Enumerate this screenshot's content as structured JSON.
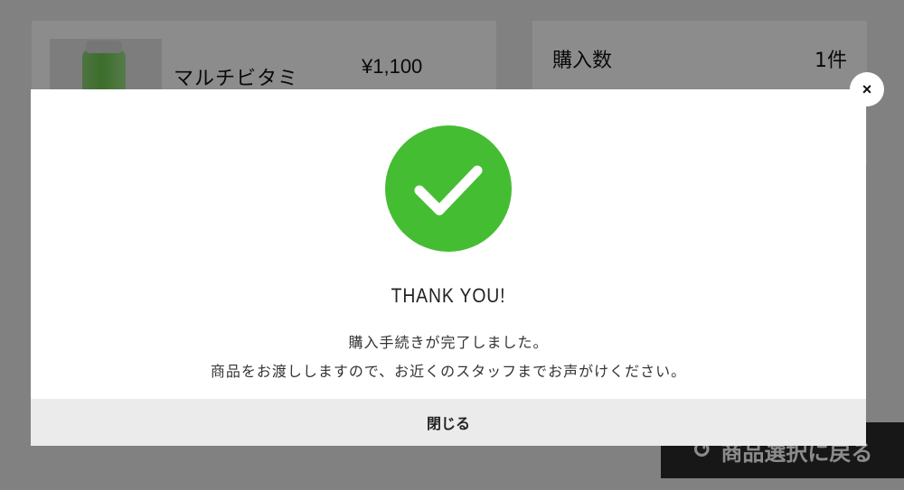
{
  "background": {
    "product": {
      "name": "マルチビタミ",
      "price": "¥1,100"
    },
    "summary": {
      "quantity_label": "購入数",
      "quantity_value": "1件"
    },
    "back_button": {
      "icon": "return-arrow-icon",
      "label": "商品選択に戻る"
    }
  },
  "modal": {
    "icon": "checkmark-icon",
    "icon_color": "#45bd33",
    "title": "THANK YOU!",
    "message_line1": "購入手続きが完了しました。",
    "message_line2": "商品をお渡ししますので、お近くのスタッフまでお声がけください。",
    "close_button_label": "閉じる",
    "close_icon": "×"
  }
}
